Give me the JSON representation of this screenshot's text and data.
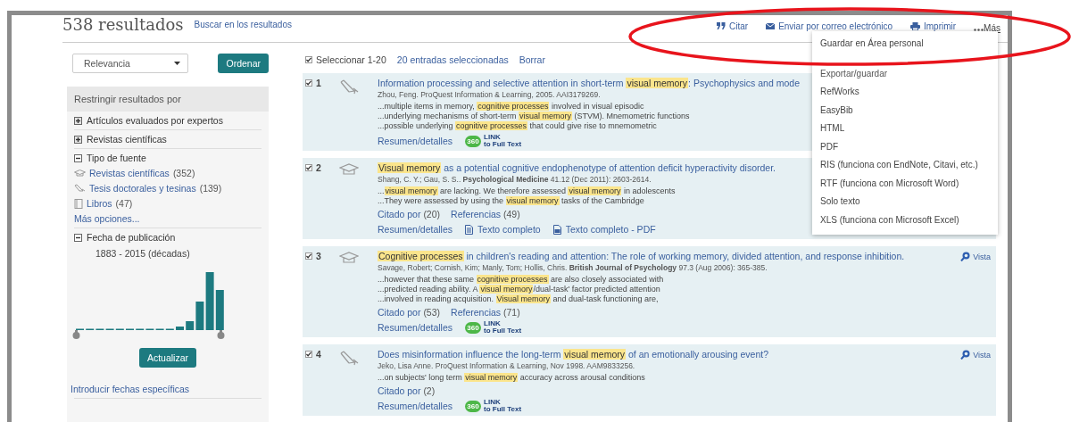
{
  "header": {
    "count": "538 resultados",
    "search_within": "Buscar en los resultados",
    "actions": [
      {
        "kind": "cite",
        "label": "Citar"
      },
      {
        "kind": "email",
        "label": "Enviar por correo electrónico"
      },
      {
        "kind": "print",
        "label": "Imprimir"
      },
      {
        "kind": "more",
        "label": "Más"
      }
    ]
  },
  "more_menu": {
    "items": [
      {
        "kind": "action",
        "label": "Guardar en Área personal"
      },
      {
        "kind": "header",
        "label": "Exportar/guardar"
      },
      {
        "kind": "option",
        "label": "RefWorks"
      },
      {
        "kind": "option",
        "label": "EasyBib"
      },
      {
        "kind": "option",
        "label": "HTML"
      },
      {
        "kind": "option",
        "label": "PDF"
      },
      {
        "kind": "option",
        "label": "RIS (funciona con EndNote, Citavi, etc.)"
      },
      {
        "kind": "option",
        "label": "RTF (funciona con Microsoft Word)"
      },
      {
        "kind": "option",
        "label": "Solo texto"
      },
      {
        "kind": "option",
        "label": "XLS (funciona con Microsoft Excel)"
      }
    ]
  },
  "sort": {
    "value": "Relevancia",
    "button": "Ordenar"
  },
  "refine": {
    "title": "Restringir resultados por",
    "facets": [
      {
        "kind": "simple",
        "label": "Artículos evaluados por expertos",
        "expanded": false
      },
      {
        "kind": "simple",
        "label": "Revistas científicas",
        "expanded": false
      },
      {
        "kind": "source",
        "label": "Tipo de fuente",
        "expanded": true,
        "options": [
          {
            "kind": "journal",
            "label": "Revistas científicas",
            "count": "(352)"
          },
          {
            "kind": "dissertation",
            "label": "Tesis doctorales y tesinas",
            "count": "(139)"
          },
          {
            "kind": "book",
            "label": "Libros",
            "count": "(47)"
          }
        ],
        "more": "Más opciones..."
      },
      {
        "kind": "date",
        "label": "Fecha de publicación",
        "expanded": true,
        "range": "1883 - 2015 (décadas)",
        "button": "Actualizar",
        "link": "Introducir fechas específicas"
      }
    ]
  },
  "selection": {
    "checked": true,
    "label": "Seleccionar 1-20",
    "count": "20 entradas seleccionadas",
    "clear": "Borrar"
  },
  "results": [
    {
      "number": "1",
      "checked": true,
      "kind": "dissertation",
      "title": [
        {
          "text": "Information processing and selective attention in short-term ",
          "highlight": false
        },
        {
          "text": "visual memory",
          "highlight": true
        },
        {
          "text": ": Psychophysics and mode",
          "highlight": false
        }
      ],
      "citation": "Zhou, Feng. ProQuest Information & Learning, 2005. AAI3179269.",
      "snippets": [
        [
          {
            "text": "...multiple items in memory, ",
            "highlight": false
          },
          {
            "text": "cognitive processes",
            "highlight": true
          },
          {
            "text": " involved in visual episodic",
            "highlight": false
          }
        ],
        [
          {
            "text": "...underlying mechanisms of short-term ",
            "highlight": false
          },
          {
            "text": "visual memory",
            "highlight": true
          },
          {
            "text": " (STVM). Mnemometric functions",
            "highlight": false
          }
        ],
        [
          {
            "text": "...possible underlying ",
            "highlight": false
          },
          {
            "text": "cognitive processes",
            "highlight": true
          },
          {
            "text": " that could give rise to mnemometric",
            "highlight": false
          }
        ]
      ],
      "links": [
        {
          "kind": "abstract",
          "label": "Resumen/detalles"
        },
        {
          "kind": "resolver",
          "badge": "360",
          "line1": "LINK",
          "line2": "to Full Text"
        }
      ]
    },
    {
      "number": "2",
      "checked": true,
      "kind": "journal",
      "title": [
        {
          "text": "Visual memory",
          "highlight": true
        },
        {
          "text": " as a potential cognitive endophenotype of attention deficit hyperactivity disorder.",
          "highlight": false
        }
      ],
      "citation": "Shang, C. Y.; Gau, S. S.. **Psychological Medicine** 41.12  (Dec 2011): 2603-2614.",
      "snippets": [
        [
          {
            "text": "...",
            "highlight": false
          },
          {
            "text": "visual memory",
            "highlight": true
          },
          {
            "text": " are lacking. We therefore assessed ",
            "highlight": false
          },
          {
            "text": "visual memory",
            "highlight": true
          },
          {
            "text": " in adolescents",
            "highlight": false
          }
        ],
        [
          {
            "text": "...They were assessed by using the ",
            "highlight": false
          },
          {
            "text": "visual memory",
            "highlight": true
          },
          {
            "text": " tasks of the Cambridge",
            "highlight": false
          }
        ]
      ],
      "metrics": [
        {
          "label": "Citado por",
          "count": "(20)"
        },
        {
          "label": "Referencias",
          "count": "(49)"
        }
      ],
      "links": [
        {
          "kind": "abstract",
          "label": "Resumen/detalles"
        },
        {
          "kind": "fulltext",
          "label": "Texto completo"
        },
        {
          "kind": "pdf",
          "label": "Texto completo - PDF"
        }
      ]
    },
    {
      "number": "3",
      "checked": true,
      "kind": "journal",
      "title": [
        {
          "text": "Cognitive processes",
          "highlight": true
        },
        {
          "text": " in children's reading and attention: The role of working memory, divided attention, and response inhibition.",
          "highlight": false
        }
      ],
      "citation": "Savage, Robert; Cornish, Kim; Manly, Tom; Hollis, Chris. **British Journal of Psychology** 97.3  (Aug 2006): 365-385.",
      "snippets": [
        [
          {
            "text": "...however that these same ",
            "highlight": false
          },
          {
            "text": "cognitive processes",
            "highlight": true
          },
          {
            "text": " are also closely associated with",
            "highlight": false
          }
        ],
        [
          {
            "text": "...predicted reading ability. A ",
            "highlight": false
          },
          {
            "text": "visual memory",
            "highlight": true
          },
          {
            "text": "/dual-task' factor predicted attention",
            "highlight": false
          }
        ],
        [
          {
            "text": "...involved in reading acquisition. ",
            "highlight": false
          },
          {
            "text": "Visual memory",
            "highlight": true
          },
          {
            "text": " and dual-task functioning are,",
            "highlight": false
          }
        ]
      ],
      "metrics": [
        {
          "label": "Citado por",
          "count": "(53)"
        },
        {
          "label": "Referencias",
          "count": "(71)"
        }
      ],
      "links": [
        {
          "kind": "abstract",
          "label": "Resumen/detalles"
        },
        {
          "kind": "resolver",
          "badge": "360",
          "line1": "LINK",
          "line2": "to Full Text"
        }
      ],
      "preview": "Vista"
    },
    {
      "number": "4",
      "checked": true,
      "kind": "dissertation",
      "title": [
        {
          "text": "Does misinformation influence the long-term ",
          "highlight": false
        },
        {
          "text": "visual memory",
          "highlight": true
        },
        {
          "text": " of an emotionally arousing event?",
          "highlight": false
        }
      ],
      "citation": "Jeko, Lisa Anne. ProQuest Information & Learning, Nov 1998. AAM9833256.",
      "snippets": [
        [
          {
            "text": "...on subjects' long term ",
            "highlight": false
          },
          {
            "text": "visual memory",
            "highlight": true
          },
          {
            "text": " accuracy across arousal conditions",
            "highlight": false
          }
        ]
      ],
      "metrics": [
        {
          "label": "Citado por",
          "count": "(2)"
        }
      ],
      "links": [
        {
          "kind": "abstract",
          "label": "Resumen/detalles"
        },
        {
          "kind": "resolver",
          "badge": "360",
          "line1": "LINK",
          "line2": "to Full Text"
        }
      ],
      "preview": "Vista"
    }
  ]
}
